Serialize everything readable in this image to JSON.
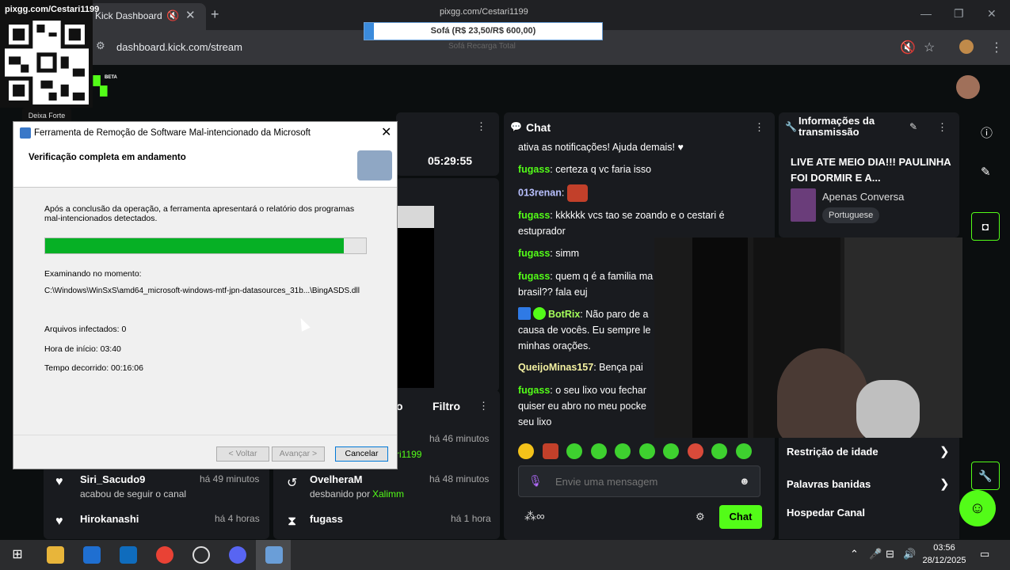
{
  "browser": {
    "tab_title": "Kick Dashboard",
    "url": "dashboard.kick.com/stream"
  },
  "overlay": {
    "qr_url": "pixgg.com/Cestari1199",
    "qr_caption": "Deixa Forte",
    "donation_url": "pixgg.com/Cestari1199",
    "donation_goal": "Sofá (R$ 23,50/R$ 600,00)",
    "donation_progress_fraction": 0.04,
    "donation_sub": "Sofá Recarga Total"
  },
  "kick": {
    "beta_label": "BETA",
    "timer": "05:29:55",
    "filter_label": "Filtro",
    "filter_partial": "o"
  },
  "activity_feed": [
    {
      "name": "Siri_Sacudo9",
      "time": "há 49 minutos",
      "sub": "acabou de seguir o canal",
      "icon": "heart-icon"
    },
    {
      "name": "Hirokanashi",
      "time": "há 4 horas",
      "sub": "",
      "icon": "heart-icon"
    },
    {
      "name": "",
      "time": "há 46 minutos",
      "sub": "ri1199",
      "icon": ""
    },
    {
      "name": "OvelheraM",
      "time": "há 48 minutos",
      "sub": "desbanido por",
      "sub_user": "Xalimm",
      "icon": "undo-icon"
    },
    {
      "name": "fugass",
      "time": "há 1 hora",
      "sub": "",
      "icon": "hourglass-icon"
    }
  ],
  "chat": {
    "title": "Chat",
    "input_placeholder": "Envie uma mensagem",
    "send_label": "Chat",
    "messages": [
      {
        "user": "",
        "text": "ativa as notificações! Ajuda demais! ♥"
      },
      {
        "user": "fugass",
        "text": ": certeza q vc faria isso"
      },
      {
        "user": "013renan",
        "text": ":"
      },
      {
        "user": "fugass",
        "text": ": kkkkkk vcs tao se zoando e o cestari é estuprador"
      },
      {
        "user": "fugass",
        "text": ": simm"
      },
      {
        "user": "fugass",
        "text": ": quem q é a familia ma brasil?? fala euj"
      },
      {
        "user": "BotRix",
        "text": ": Não paro de a causa de vocês. Eu sempre le minhas orações."
      },
      {
        "user": "QueijoMinas157",
        "text": ": Bença pai"
      },
      {
        "user": "fugass",
        "text": ": o seu lixo vou fechar quiser eu abro no meu pocke seu lixo"
      }
    ]
  },
  "info": {
    "title": "Informações da transmissão",
    "stream_title": "LIVE ATE MEIO DIA!!! PAULINHA FOI DORMIR E A...",
    "category": "Apenas Conversa",
    "language": "Portuguese"
  },
  "mod_menu": [
    "Restrição de idade",
    "Palavras banidas",
    "Hospedar Canal"
  ],
  "dialog": {
    "title": "Ferramenta de Remoção de Software Mal-intencionado da Microsoft",
    "heading": "Verificação completa  em andamento",
    "desc": "Após a conclusão da operação, a ferramenta apresentará o relatório dos programas mal-intencionados detectados.",
    "progress_fraction": 0.93,
    "scanning_label": "Examinando no momento:",
    "scanning_path": "C:\\Windows\\WinSxS\\amd64_microsoft-windows-mtf-jpn-datasources_31b...\\BingASDS.dll",
    "infected": "Arquivos infectados: 0",
    "start_time": "Hora de início: 03:40",
    "elapsed": "Tempo decorrido: 00:16:06",
    "back_label": "< Voltar",
    "next_label": "Avançar >",
    "cancel_label": "Cancelar"
  },
  "taskbar": {
    "time": "03:56",
    "date": "28/12/2025"
  },
  "colors": {
    "kick_green": "#53fc18",
    "progress_green": "#06b025",
    "panel": "#191b1f"
  }
}
